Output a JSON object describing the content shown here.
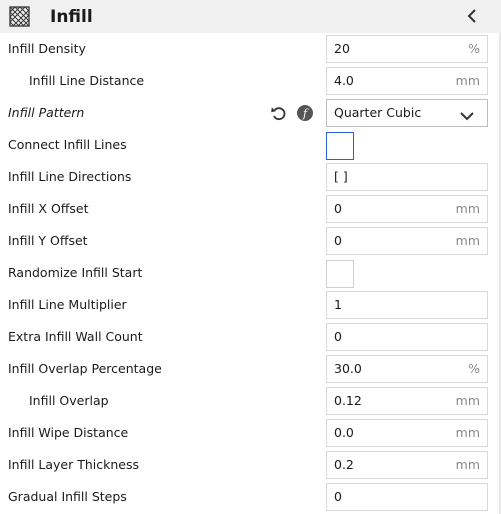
{
  "header": {
    "title": "Infill",
    "category_icon": "infill-category-icon",
    "collapse_icon": "chevron-left-icon"
  },
  "settings": [
    {
      "label": "Infill Density",
      "value": "20",
      "unit": "%"
    },
    {
      "label": "Infill Line Distance",
      "value": "4.0",
      "unit": "mm"
    },
    {
      "label": "Infill Pattern",
      "value": "Quarter Cubic",
      "icons": [
        "reset-icon",
        "function-icon"
      ]
    },
    {
      "label": "Connect Infill Lines",
      "checked": false
    },
    {
      "label": "Infill Line Directions",
      "value": "[ ]"
    },
    {
      "label": "Infill X Offset",
      "value": "0",
      "unit": "mm"
    },
    {
      "label": "Infill Y Offset",
      "value": "0",
      "unit": "mm"
    },
    {
      "label": "Randomize Infill Start",
      "checked": false
    },
    {
      "label": "Infill Line Multiplier",
      "value": "1"
    },
    {
      "label": "Extra Infill Wall Count",
      "value": "0"
    },
    {
      "label": "Infill Overlap Percentage",
      "value": "30.0",
      "unit": "%"
    },
    {
      "label": "Infill Overlap",
      "value": "0.12",
      "unit": "mm"
    },
    {
      "label": "Infill Wipe Distance",
      "value": "0.0",
      "unit": "mm"
    },
    {
      "label": "Infill Layer Thickness",
      "value": "0.2",
      "unit": "mm"
    },
    {
      "label": "Gradual Infill Steps",
      "value": "0"
    }
  ],
  "colors": {
    "header_bg": "#f0f0f0",
    "field_border": "#d8d8d8",
    "focus_border": "#2a5fd4",
    "unit_text": "#8a8a8a"
  }
}
